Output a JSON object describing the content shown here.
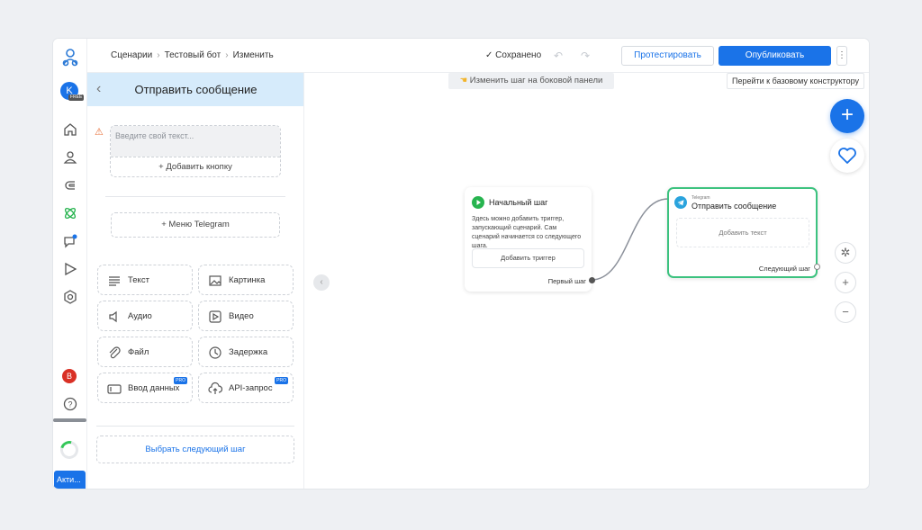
{
  "colors": {
    "accent": "#1a73e8",
    "success": "#27b44f",
    "node_selected_border": "#3cc27f",
    "panel_header": "#d6ebfb",
    "warning": "#e8703a"
  },
  "sidebar": {
    "avatar_letter": "K",
    "plan_badge": "FREE",
    "items": [
      {
        "icon": "home-icon"
      },
      {
        "icon": "user-icon"
      },
      {
        "icon": "magnet-icon"
      },
      {
        "icon": "scenarios-icon",
        "active": true
      },
      {
        "icon": "chat-icon",
        "notification": true
      },
      {
        "icon": "send-icon"
      },
      {
        "icon": "settings-icon"
      }
    ],
    "user_badge": "B",
    "help_icon": "question-icon",
    "activate_label": "Акти..."
  },
  "topbar": {
    "breadcrumbs": [
      "Сценарии",
      "Тестовый бот",
      "Изменить"
    ],
    "saved_label": "Сохранено",
    "undo_icon": "undo-icon",
    "redo_icon": "redo-icon",
    "test_label": "Протестировать",
    "publish_label": "Опубликовать",
    "more_icon": "more-vertical-icon"
  },
  "panel": {
    "title": "Отправить сообщение",
    "message_placeholder": "Введите свой текст...",
    "add_button_label": "+ Добавить кнопку",
    "telegram_menu_label": "+ Меню Telegram",
    "tiles": [
      {
        "label": "Текст",
        "icon": "text-icon",
        "pro": false
      },
      {
        "label": "Картинка",
        "icon": "image-icon",
        "pro": false
      },
      {
        "label": "Аудио",
        "icon": "audio-icon",
        "pro": false
      },
      {
        "label": "Видео",
        "icon": "video-icon",
        "pro": false
      },
      {
        "label": "Файл",
        "icon": "paperclip-icon",
        "pro": false
      },
      {
        "label": "Задержка",
        "icon": "clock-icon",
        "pro": false
      },
      {
        "label": "Ввод данных",
        "icon": "input-icon",
        "pro": true
      },
      {
        "label": "API-запрос",
        "icon": "cloud-upload-icon",
        "pro": true
      }
    ],
    "pro_badge": "PRO",
    "next_step_label": "Выбрать следующий шаг"
  },
  "canvas": {
    "hint": "Изменить шаг на боковой панели",
    "basic_constructor_link": "Перейти к базовому конструктору",
    "start_node": {
      "title": "Начальный шаг",
      "description": "Здесь можно добавить триггер, запускающий сценарий. Сам сценарий начинается со следующего шага.",
      "add_trigger_label": "Добавить триггер",
      "output_label": "Первый шаг"
    },
    "message_node": {
      "channel": "Telegram",
      "title": "Отправить сообщение",
      "add_text_label": "Добавить текст",
      "output_label": "Следующий шаг"
    },
    "zoom_in": "+",
    "zoom_out": "−"
  }
}
